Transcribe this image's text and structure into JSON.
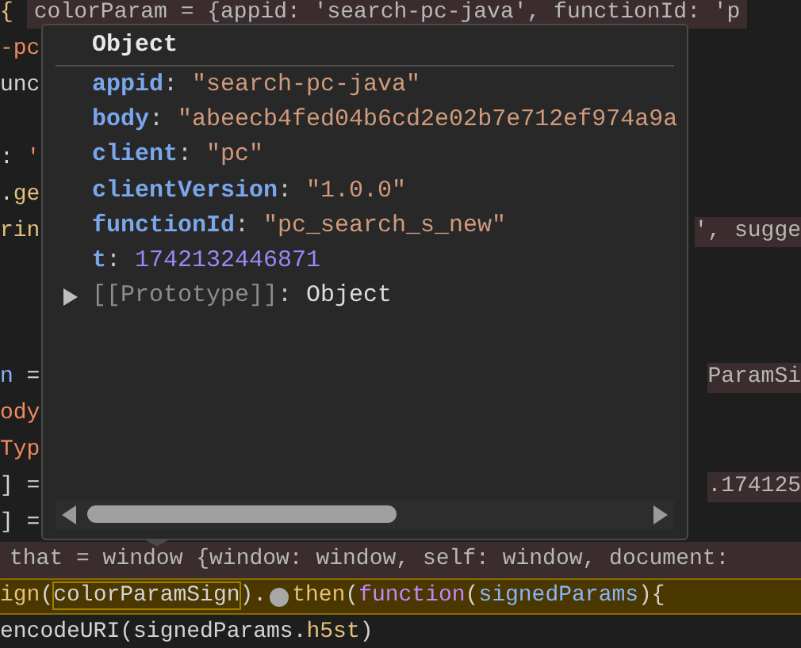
{
  "code_lines": [
    {
      "kind": "code",
      "tokens": [
        {
          "text": "{",
          "kind": "func"
        },
        {
          "text": "colorParam = {appid: 'search-pc-java', functionId: 'p",
          "kind": "inline"
        }
      ]
    },
    {
      "kind": "code",
      "tokens": [
        {
          "text": "-pc",
          "kind": "string"
        }
      ]
    },
    {
      "kind": "code",
      "tokens": [
        {
          "text": "unc",
          "kind": "plain"
        }
      ]
    },
    {
      "kind": "blank"
    },
    {
      "kind": "code",
      "tokens": [
        {
          "text": ":",
          "kind": "plain"
        },
        {
          "text": " '",
          "kind": "string"
        }
      ]
    },
    {
      "kind": "code",
      "tokens": [
        {
          "text": ".",
          "kind": "plain"
        },
        {
          "text": "ge",
          "kind": "func"
        }
      ]
    },
    {
      "kind": "code",
      "tokens": [
        {
          "text": "rin",
          "kind": "func"
        }
      ],
      "tail": "', sugge"
    },
    {
      "kind": "blank"
    },
    {
      "kind": "blank"
    },
    {
      "kind": "blank"
    },
    {
      "kind": "code",
      "tokens": [
        {
          "text": "n",
          "kind": "var"
        },
        {
          "text": " =",
          "kind": "plain"
        }
      ],
      "tail": "ParamSi"
    },
    {
      "kind": "code",
      "tokens": [
        {
          "text": "ody",
          "kind": "string"
        }
      ]
    },
    {
      "kind": "code",
      "tokens": [
        {
          "text": "Typ",
          "kind": "string"
        }
      ]
    },
    {
      "kind": "code",
      "tokens": [
        {
          "text": "] =",
          "kind": "plain"
        }
      ],
      "tail": ".174125"
    },
    {
      "kind": "code",
      "tokens": [
        {
          "text": "] =",
          "kind": "plain"
        }
      ]
    },
    {
      "kind": "inline",
      "tokens": [
        {
          "text": "that = window {window: window, self: window, document:",
          "kind": "faded"
        }
      ]
    },
    {
      "kind": "paused",
      "tokens": [
        {
          "text": "ign",
          "kind": "func"
        },
        {
          "text": "(",
          "kind": "plain"
        },
        {
          "text": "colorParamSign",
          "kind": "boxed"
        },
        {
          "text": ").",
          "kind": "plain"
        },
        {
          "kind": "marker"
        },
        {
          "text": "then",
          "kind": "func"
        },
        {
          "text": "(",
          "kind": "plain"
        },
        {
          "text": "function",
          "kind": "keyword"
        },
        {
          "text": "(",
          "kind": "plain"
        },
        {
          "text": "signedParams",
          "kind": "var"
        },
        {
          "text": "){",
          "kind": "plain"
        }
      ]
    },
    {
      "kind": "code",
      "tokens": [
        {
          "text": "encodeURI(signedParams.",
          "kind": "plain"
        },
        {
          "text": "h5st",
          "kind": "func"
        },
        {
          "text": ")",
          "kind": "plain"
        }
      ]
    }
  ],
  "popover": {
    "title": "Object",
    "properties": [
      {
        "key": "appid",
        "sep": ":",
        "value": "\"search-pc-java\"",
        "kind": "string"
      },
      {
        "key": "body",
        "sep": ":",
        "value": "\"abeecb4fed04b6cd2e02b7e712ef974a9a",
        "kind": "string"
      },
      {
        "key": "client",
        "sep": ":",
        "value": "\"pc\"",
        "kind": "string"
      },
      {
        "key": "clientVersion",
        "sep": ":",
        "value": "\"1.0.0\"",
        "kind": "string"
      },
      {
        "key": "functionId",
        "sep": ":",
        "value": "\"pc_search_s_new\"",
        "kind": "string"
      },
      {
        "key": "t",
        "sep": ":",
        "value": "1742132446871",
        "kind": "number"
      }
    ],
    "prototype": {
      "label": "[[Prototype]]",
      "sep": ":",
      "value": "Object",
      "expanded": false
    }
  }
}
